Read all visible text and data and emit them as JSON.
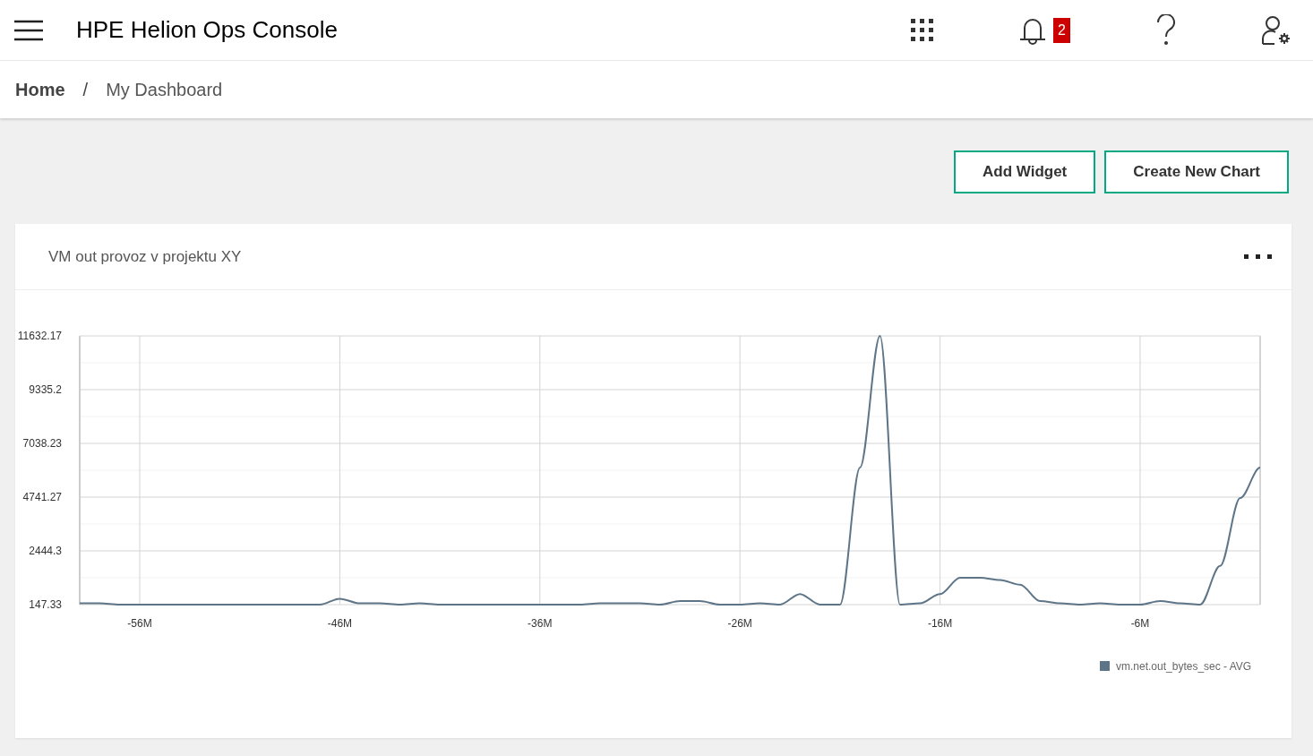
{
  "header": {
    "title": "HPE Helion Ops Console",
    "notification_count": "2"
  },
  "breadcrumb": {
    "separator": "/",
    "items": [
      {
        "label": "Home",
        "current": false
      },
      {
        "label": "My Dashboard",
        "current": true
      }
    ]
  },
  "actions": [
    {
      "label": "Add Widget"
    },
    {
      "label": "Create New Chart"
    }
  ],
  "widgets": [
    {
      "title": "VM out provoz v projektu XY",
      "chart_data": {
        "type": "line",
        "x": [
          -59,
          -58,
          -57,
          -56,
          -55,
          -54,
          -53,
          -52,
          -51,
          -50,
          -49,
          -48,
          -47,
          -46,
          -45,
          -44,
          -43,
          -42,
          -41,
          -40,
          -39,
          -38,
          -37,
          -36,
          -35,
          -34,
          -33,
          -32,
          -31,
          -30,
          -29,
          -28,
          -27,
          -26,
          -25,
          -24,
          -23,
          -22,
          -21,
          -20,
          -19,
          -18,
          -17,
          -16,
          -15,
          -14,
          -13,
          -12,
          -11,
          -10,
          -9,
          -8,
          -7,
          -6,
          -5,
          -4,
          -3,
          -2,
          -1,
          0
        ],
        "grid": true,
        "xlim": [
          -59,
          0
        ],
        "ylim": [
          147.33,
          11632.17
        ],
        "xticks": [
          {
            "value": -56,
            "label": "-56M"
          },
          {
            "value": -46,
            "label": "-46M"
          },
          {
            "value": -36,
            "label": "-36M"
          },
          {
            "value": -26,
            "label": "-26M"
          },
          {
            "value": -16,
            "label": "-16M"
          },
          {
            "value": -6,
            "label": "-6M"
          }
        ],
        "yticks": [
          {
            "value": 147.33,
            "label": "147.33"
          },
          {
            "value": 2444.3,
            "label": "2444.3"
          },
          {
            "value": 4741.27,
            "label": "4741.27"
          },
          {
            "value": 7038.23,
            "label": "7038.23"
          },
          {
            "value": 9335.2,
            "label": "9335.2"
          },
          {
            "value": 11632.17,
            "label": "11632.17"
          }
        ],
        "series": [
          {
            "name": "vm.net.out_bytes_sec - AVG",
            "color": "#5e7588",
            "values": [
              200,
              200,
              147.33,
              147.33,
              147.33,
              147.33,
              147.33,
              147.33,
              147.33,
              147.33,
              147.33,
              147.33,
              147.33,
              400,
              200,
              200,
              147.33,
              200,
              147.33,
              147.33,
              147.33,
              147.33,
              147.33,
              147.33,
              147.33,
              147.33,
              200,
              200,
              200,
              147.33,
              300,
              300,
              147.33,
              147.33,
              200,
              147.33,
              600,
              147.33,
              147.33,
              6000,
              11632.17,
              147.33,
              200,
              600,
              1300,
              1300,
              1200,
              1000,
              300,
              200,
              147.33,
              200,
              147.33,
              147.33,
              300,
              200,
              147.33,
              1800,
              4700,
              6000
            ]
          }
        ]
      }
    }
  ]
}
